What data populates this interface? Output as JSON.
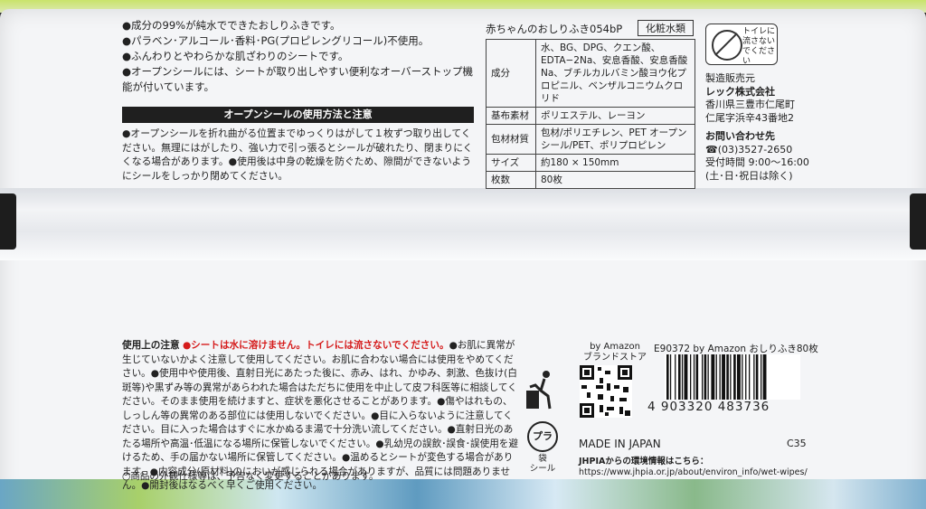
{
  "bullets": [
    "●成分の99%が純水でできたおしりふきです。",
    "●パラベン･アルコール･香料･PG(プロピレングリコール)不使用。",
    "●ふんわりとやわらかな肌ざわりのシートです。",
    "●オープンシールには、シートが取り出しやすい便利なオーバーストップ機能が付いています。"
  ],
  "usage_header": "オープンシールの使用方法と注意",
  "usage_text": "●オープンシールを折れ曲がる位置までゆっくりはがして１枚ずつ取り出してください。無理にはがしたり、強い力で引っ張るとシールが破れたり、閉まりにくくなる場合があります。●使用後は中身の乾燥を防ぐため、隙間ができないようにシールをしっかり閉めてください。",
  "product_title": "赤ちゃんのおしりふき054bP",
  "category": "化粧水類",
  "spec": [
    {
      "key": "成分",
      "value": "水、BG、DPG、クエン酸、EDTA−2Na、安息香酸、安息香酸Na、ブチルカルバミン酸ヨウ化プロピニル、ベンザルコニウムクロリド"
    },
    {
      "key": "基布素材",
      "value": "ポリエステル、レーヨン"
    },
    {
      "key": "包材材質",
      "value": "包材/ポリエチレン、PET オープンシール/PET、ポリプロピレン"
    },
    {
      "key": "サイズ",
      "value": "約180 × 150mm"
    },
    {
      "key": "枚数",
      "value": "80枚"
    }
  ],
  "toilet_label": "トイレに流さないでください",
  "maker": {
    "label": "製造販売元",
    "name": "レック株式会社",
    "address1": "香川県三豊市仁尾町",
    "address2": "仁尾字浜辛43番地2",
    "contact_label": "お問い合わせ先",
    "phone": "☎(03)3527-2650",
    "hours": "受付時間 9:00～16:00",
    "hours_note": "(土･日･祝日は除く)"
  },
  "caution_label": "使用上の注意",
  "caution_red": "●シートは水に溶けません。トイレには流さないでください。",
  "caution_text": "●お肌に異常が生じていないかよく注意して使用してください。お肌に合わない場合には使用をやめてください。●使用中や使用後、直射日光にあたった後に、赤み、はれ、かゆみ、刺激、色抜け(白斑等)や黒ずみ等の異常があらわれた場合はただちに使用を中止して皮フ科医等に相談してください。そのまま使用を続けますと、症状を悪化させることがあります。●傷やはれもの、しっしん等の異常のある部位には使用しないでください。●目に入らないように注意してください。目に入った場合はすぐに水かぬるま湯で十分洗い流してください。●直射日光のあたる場所や高温･低温になる場所に保管しないでください。●乳幼児の誤飲･誤食･誤使用を避けるため、手の届かない場所に保管してください。●温めるとシートが変色する場合があります。●内容成分(原材料)のにおいが感じられる場合がありますが、品質には問題ありません。●開封後はなるべく早くご使用ください。",
  "foot_note": "○商品の外観仕様等は、予告なく変更することがあります。",
  "amazon_label": "by Amazon",
  "brand_store": "ブランドストア",
  "bag_label": "袋",
  "seal_label": "シール",
  "recycle_mark": "プラ",
  "barcode_title": "E90372  by Amazon おしりふき80枚",
  "barcode_number": "4 903320 483736",
  "made_in": "MADE IN JAPAN",
  "code": "C35",
  "jhpia_label": "JHPIAからの環境情報はこちら：",
  "jhpia_url": "https://www.jhpia.or.jp/about/environ_info/wet-wipes/"
}
